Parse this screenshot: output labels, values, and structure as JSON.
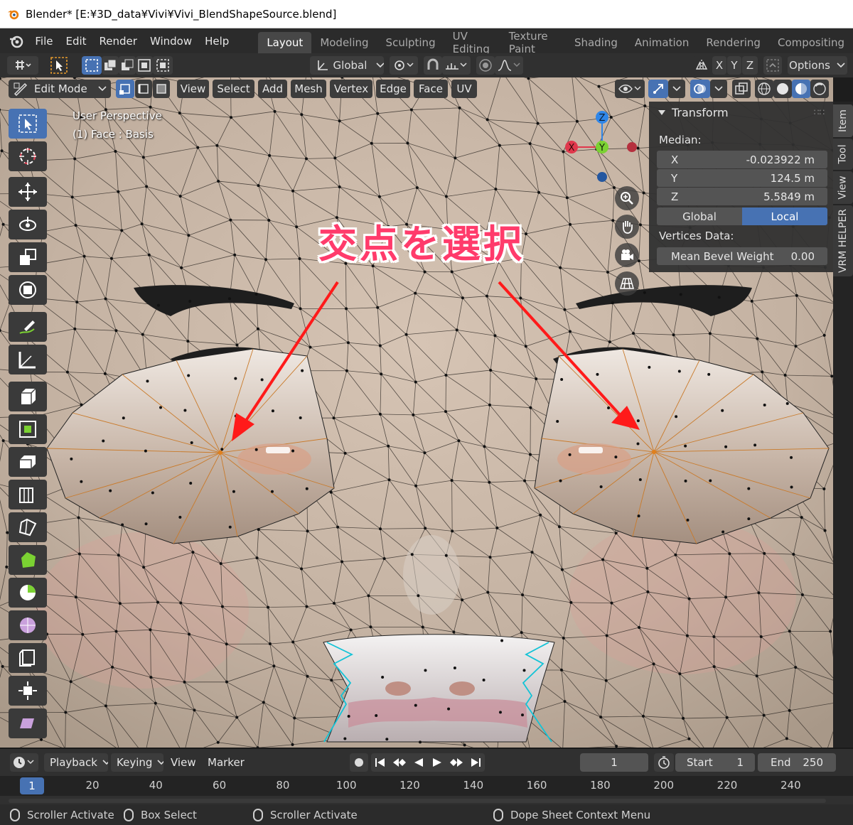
{
  "window": {
    "title": "Blender* [E:¥3D_data¥Vivi¥Vivi_BlendShapeSource.blend]"
  },
  "menu": {
    "items": [
      "File",
      "Edit",
      "Render",
      "Window",
      "Help"
    ]
  },
  "workspaces": [
    "Layout",
    "Modeling",
    "Sculpting",
    "UV Editing",
    "Texture Paint",
    "Shading",
    "Animation",
    "Rendering",
    "Compositing"
  ],
  "active_workspace": "Layout",
  "toolbar": {
    "orientation": "Global",
    "axes": [
      "X",
      "Y",
      "Z"
    ],
    "options_label": "Options"
  },
  "editor_header": {
    "mode": "Edit Mode",
    "menus": [
      "View",
      "Select",
      "Add",
      "Mesh",
      "Vertex",
      "Edge",
      "Face",
      "UV"
    ]
  },
  "viewport": {
    "perspective_label": "User Perspective",
    "object_label": "(1) Face : Basis",
    "annotation": "交点を選択",
    "gizmo": {
      "x": "X",
      "y": "Y",
      "z": "Z"
    }
  },
  "npanel": {
    "title": "Transform",
    "median_label": "Median:",
    "fields": [
      {
        "axis": "X",
        "value": "-0.023922 m"
      },
      {
        "axis": "Y",
        "value": "124.5 m"
      },
      {
        "axis": "Z",
        "value": "5.5849 m"
      }
    ],
    "space_global": "Global",
    "space_local": "Local",
    "vertices_data_label": "Vertices Data:",
    "bevel_label": "Mean Bevel Weight",
    "bevel_value": "0.00"
  },
  "side_tabs": [
    "Item",
    "Tool",
    "View",
    "VRM HELPER"
  ],
  "timeline": {
    "menus": [
      "Playback",
      "Keying",
      "View",
      "Marker"
    ],
    "current_frame": "1",
    "start_label": "Start",
    "start_value": "1",
    "end_label": "End",
    "end_value": "250",
    "ruler_current": "1",
    "ruler_ticks": [
      "20",
      "40",
      "60",
      "80",
      "100",
      "120",
      "140",
      "160",
      "180",
      "200",
      "220",
      "240"
    ]
  },
  "statusbar": {
    "items": [
      "Scroller Activate",
      "Box Select",
      "Scroller Activate",
      "Dope Sheet Context Menu"
    ]
  },
  "colors": {
    "accent": "#4772b3",
    "arrow": "#ff1a1a",
    "annotation_text": "#ff3b6b",
    "axis_x": "#e0384c",
    "axis_y": "#7bd132",
    "axis_z": "#2f86e8"
  }
}
